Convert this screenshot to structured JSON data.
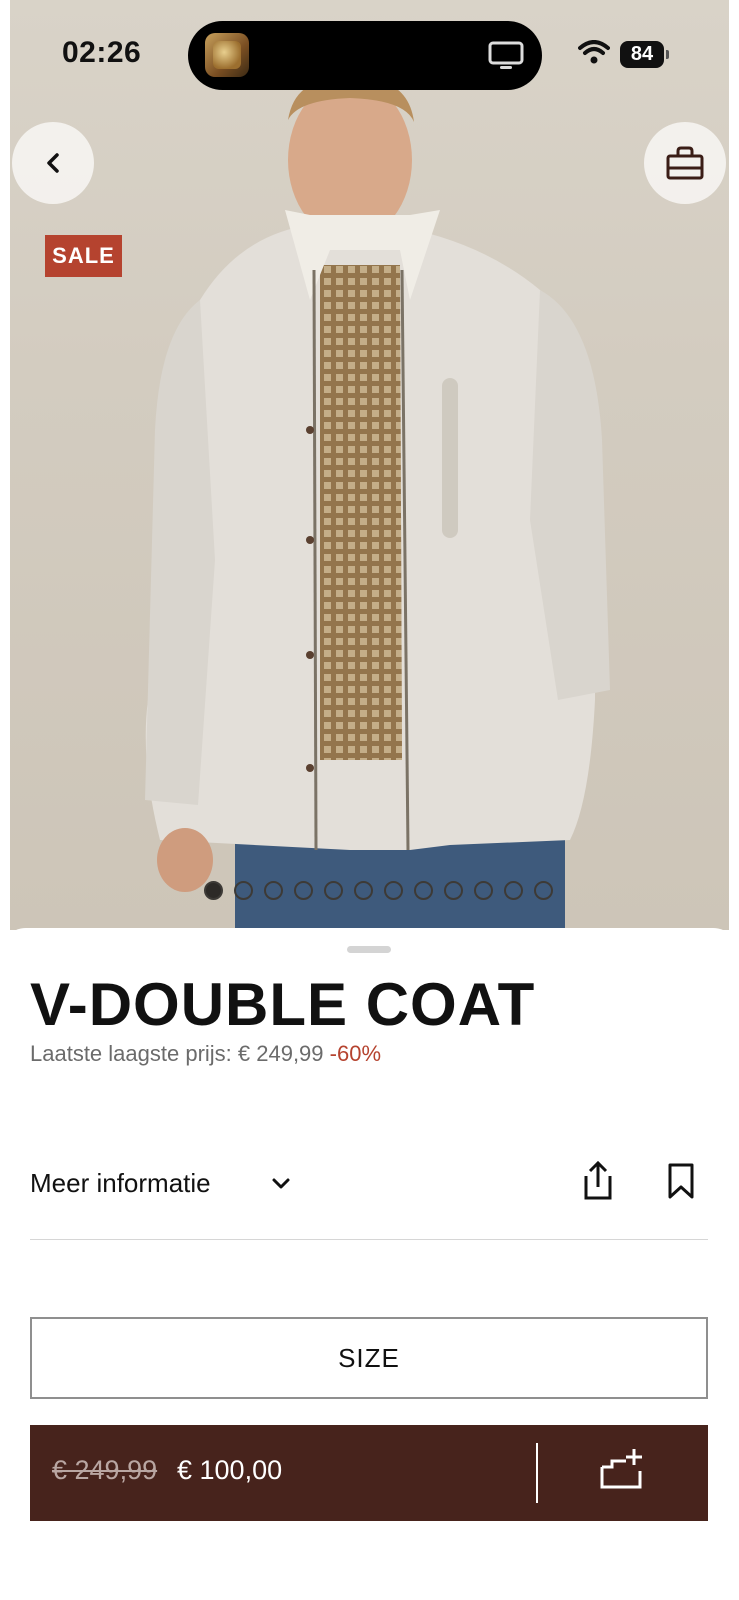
{
  "status_bar": {
    "time": "02:26",
    "battery": "84",
    "icons": [
      "tv-icon",
      "wifi-icon",
      "battery-icon"
    ]
  },
  "product": {
    "badge": "SALE",
    "title": "V-DOUBLE COAT",
    "lowest_price_label": "Laatste laagste prijs: € 249,99",
    "discount": "-60%",
    "image_count": 12,
    "active_image_index": 0
  },
  "actions": {
    "more_info_label": "Meer informatie",
    "size_label": "SIZE"
  },
  "cart": {
    "old_price": "€ 249,99",
    "new_price": "€ 100,00"
  },
  "colors": {
    "sale": "#b5432f",
    "cart_bar": "#47231c"
  }
}
